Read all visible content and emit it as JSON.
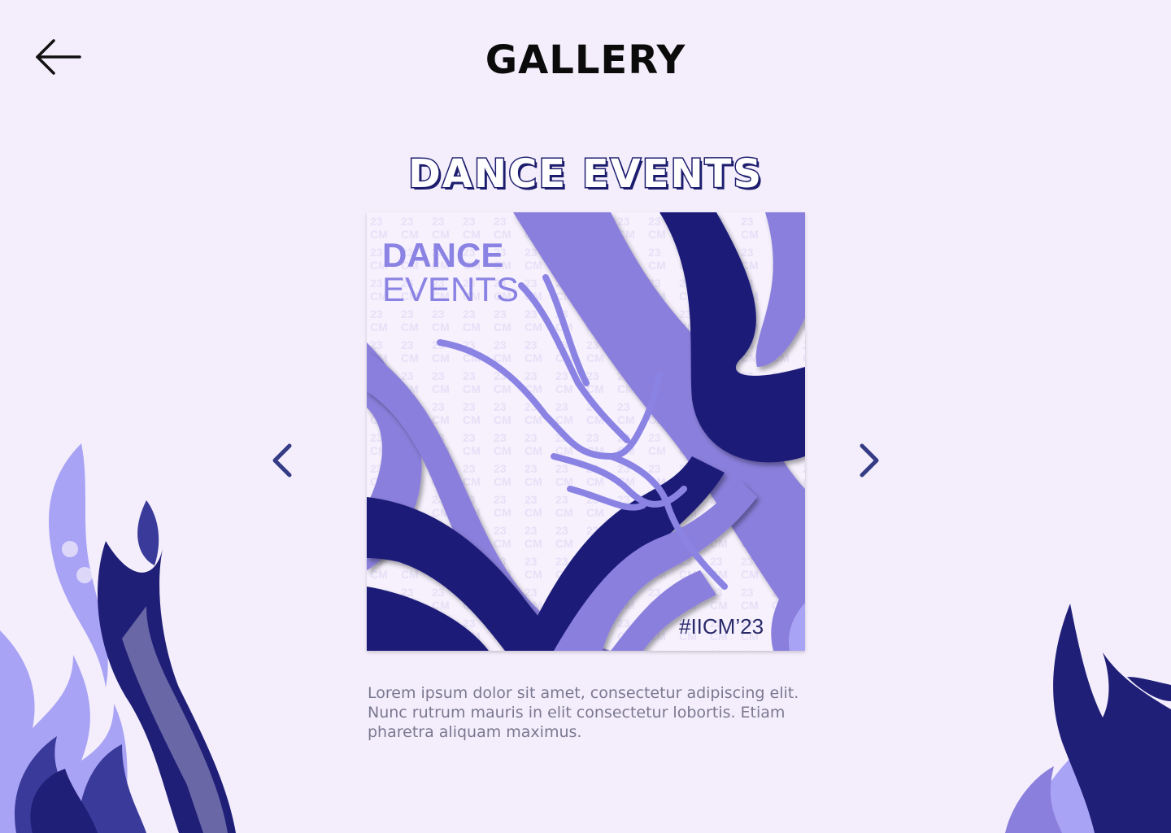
{
  "header": {
    "title": "GALLERY",
    "back_icon": "arrow-left-icon"
  },
  "section": {
    "title": "DANCE EVENTS"
  },
  "carousel": {
    "prev_icon": "chevron-left-icon",
    "next_icon": "chevron-right-icon",
    "poster": {
      "line1": "DANCE",
      "line2": "EVENTS",
      "hashtag": "#IICM’23"
    },
    "description": "Lorem ipsum dolor sit amet, consectetur adipiscing elit. Nunc rutrum mauris in elit consectetur lobortis. Etiam pharetra aliquam maximus."
  },
  "colors": {
    "background": "#f4eefc",
    "accent_dark": "#1d1d6e",
    "accent_light": "#8b83e3",
    "accent_mid": "#a9a3f5"
  }
}
